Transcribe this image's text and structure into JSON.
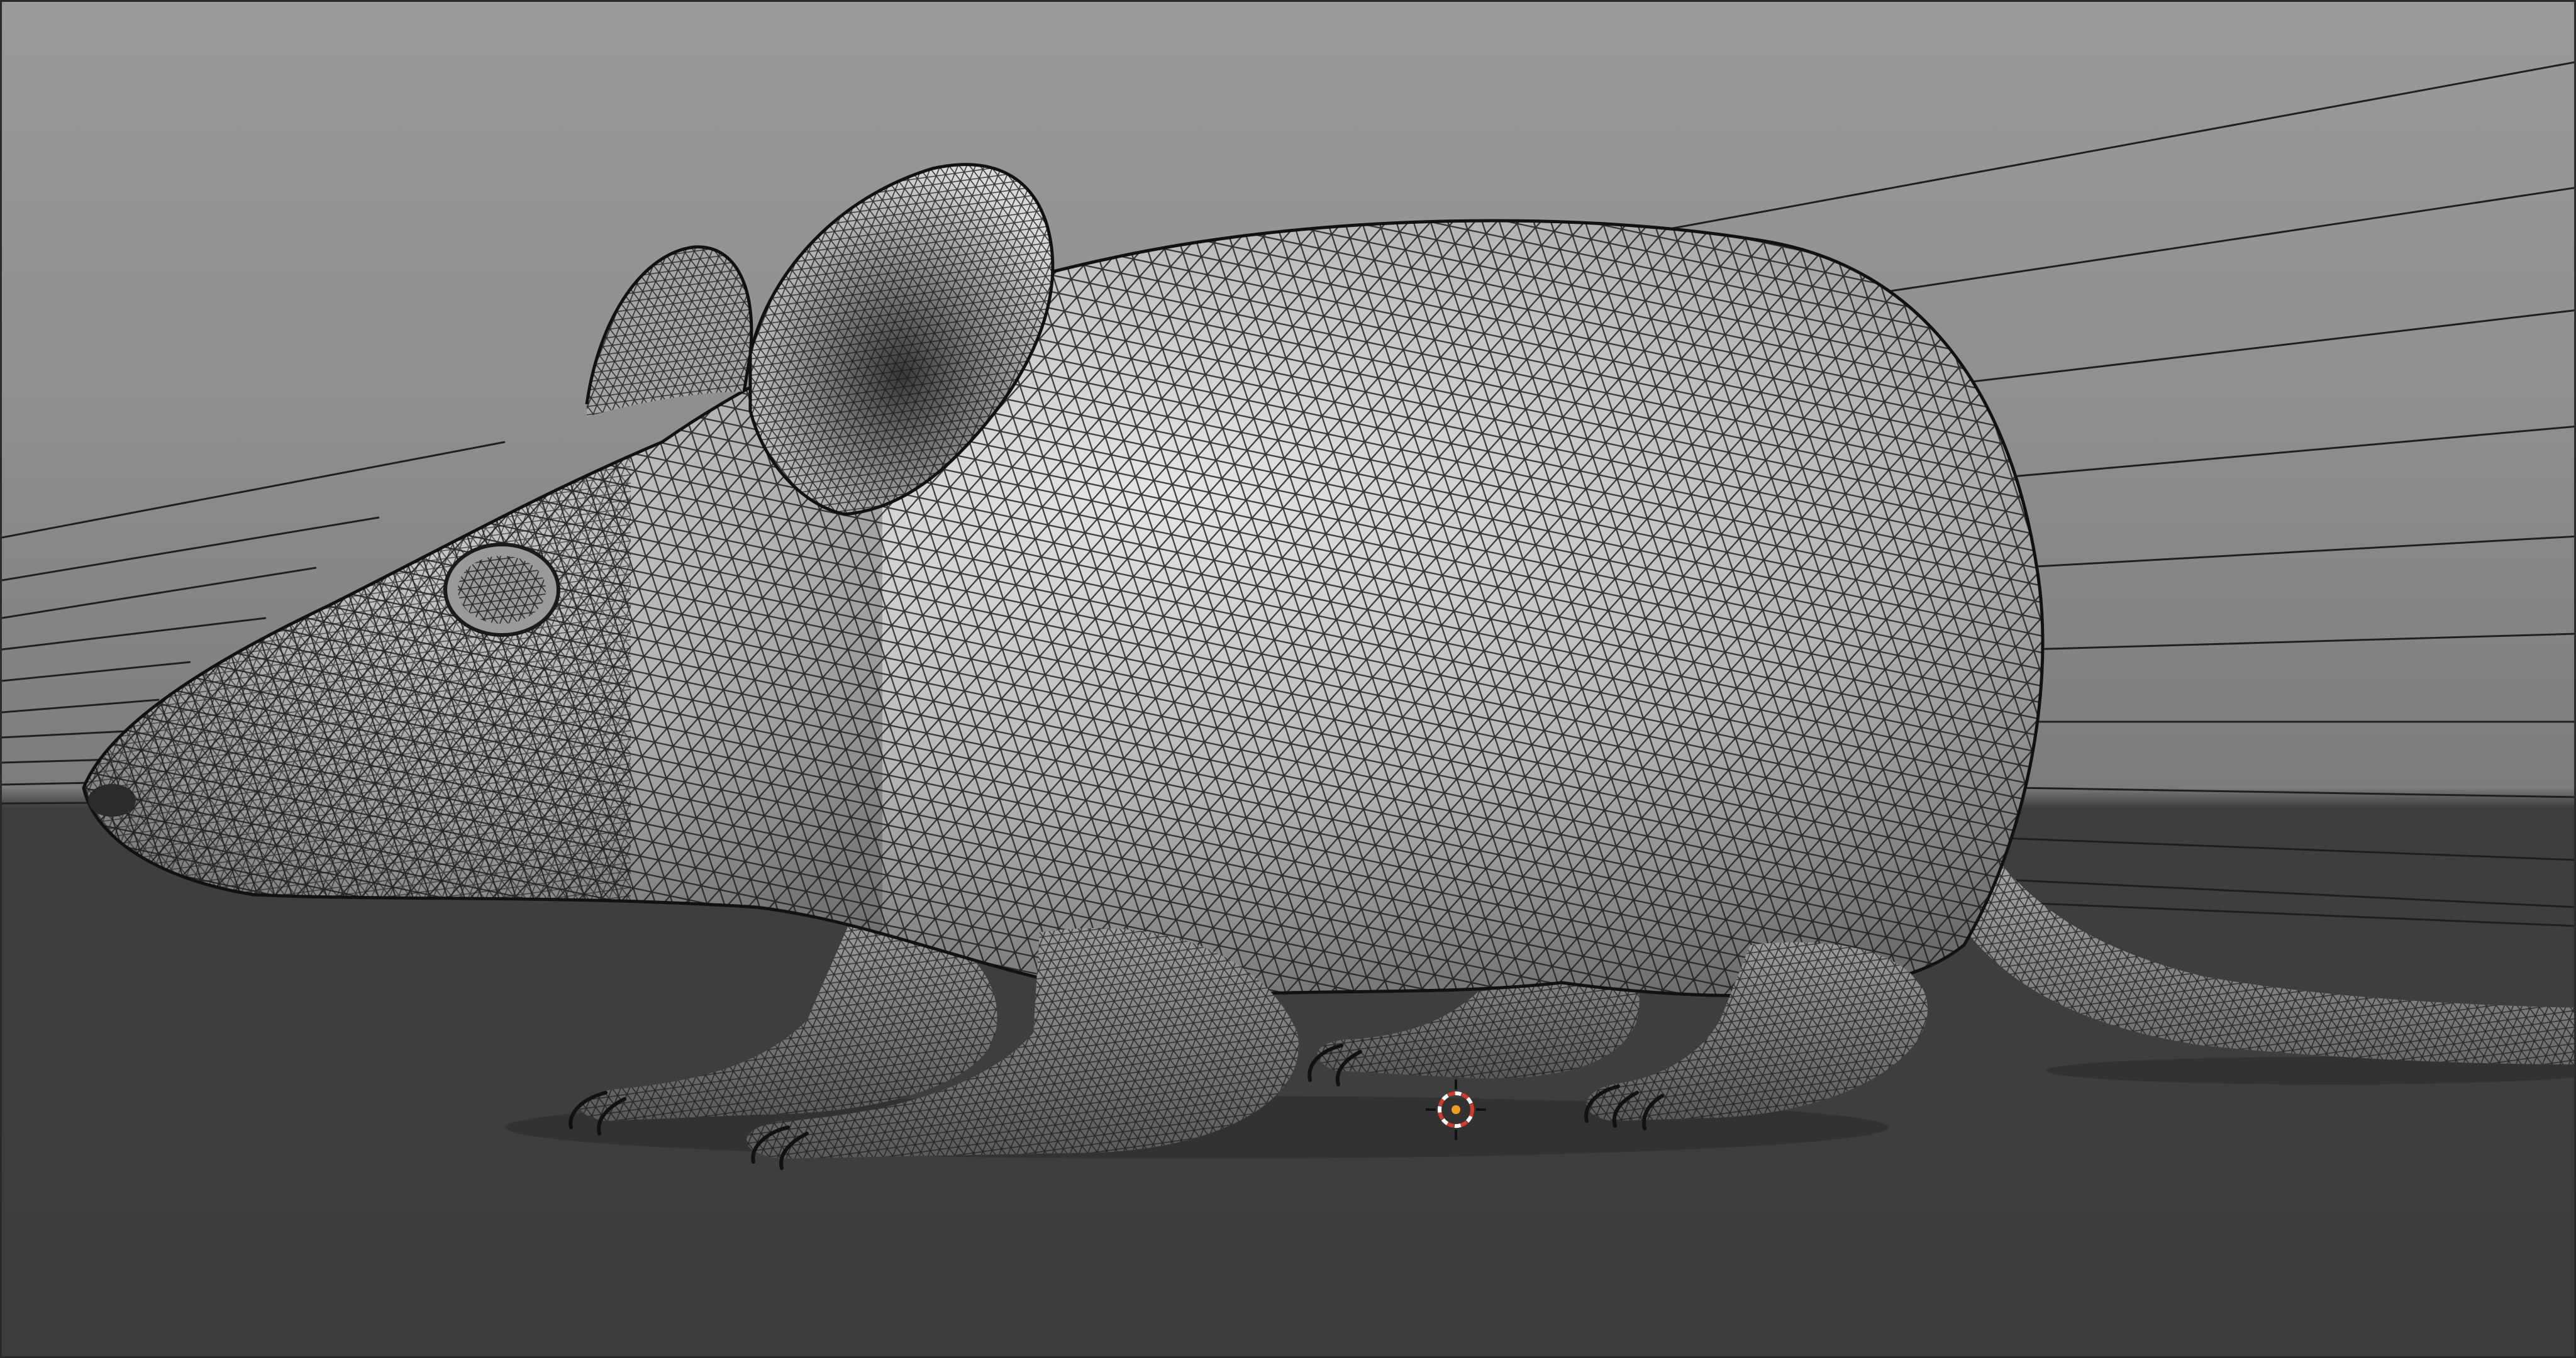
{
  "viewport": {
    "shading": "solid",
    "overlay": "wireframe",
    "object": "mouse",
    "background_color": "#8f8f8f",
    "floor_color": "#3d3d3d",
    "mesh_color": "#c9c9c9",
    "wire_color": "#1a1a1a",
    "cursor_icon": "3d-cursor-icon"
  }
}
